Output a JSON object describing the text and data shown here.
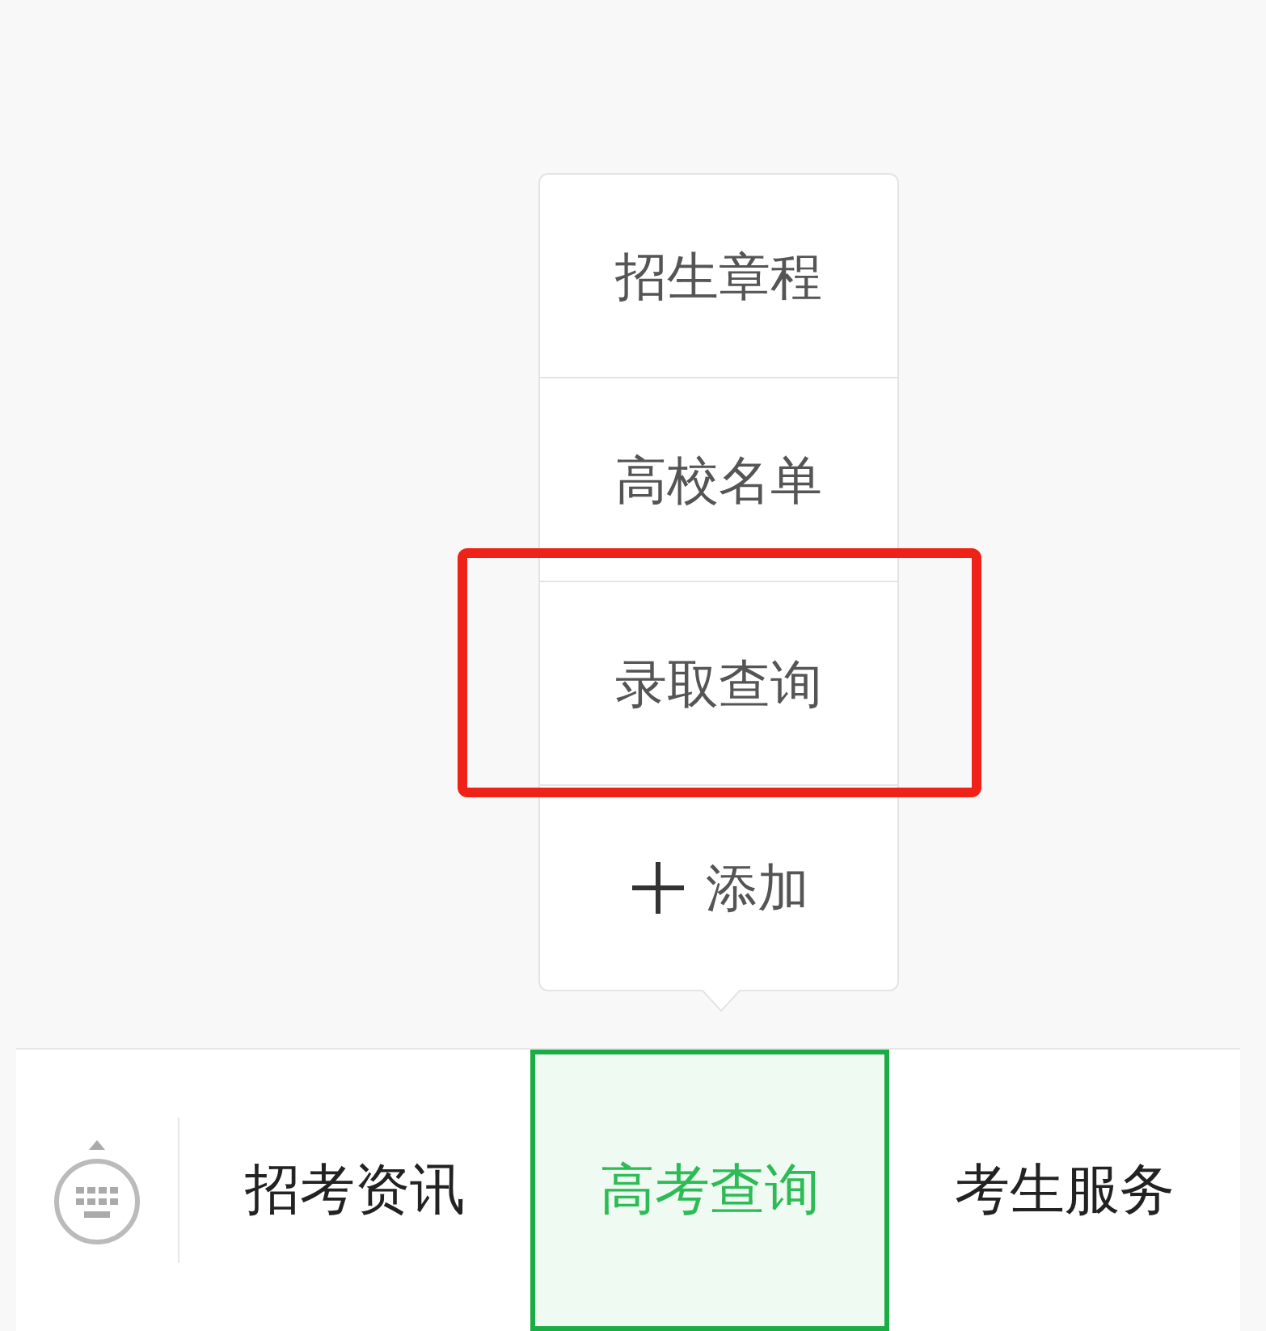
{
  "submenu": {
    "items": [
      {
        "kind": "item",
        "label": "招生章程",
        "highlighted": false
      },
      {
        "kind": "item",
        "label": "高校名单",
        "highlighted": false
      },
      {
        "kind": "item",
        "label": "录取查询",
        "highlighted": true
      },
      {
        "kind": "add",
        "label": "添加",
        "highlighted": false
      }
    ]
  },
  "menu_bar": {
    "tabs": [
      {
        "label": "招考资讯",
        "selected": false
      },
      {
        "label": "高考查询",
        "selected": true
      },
      {
        "label": "考生服务",
        "selected": false
      }
    ]
  }
}
